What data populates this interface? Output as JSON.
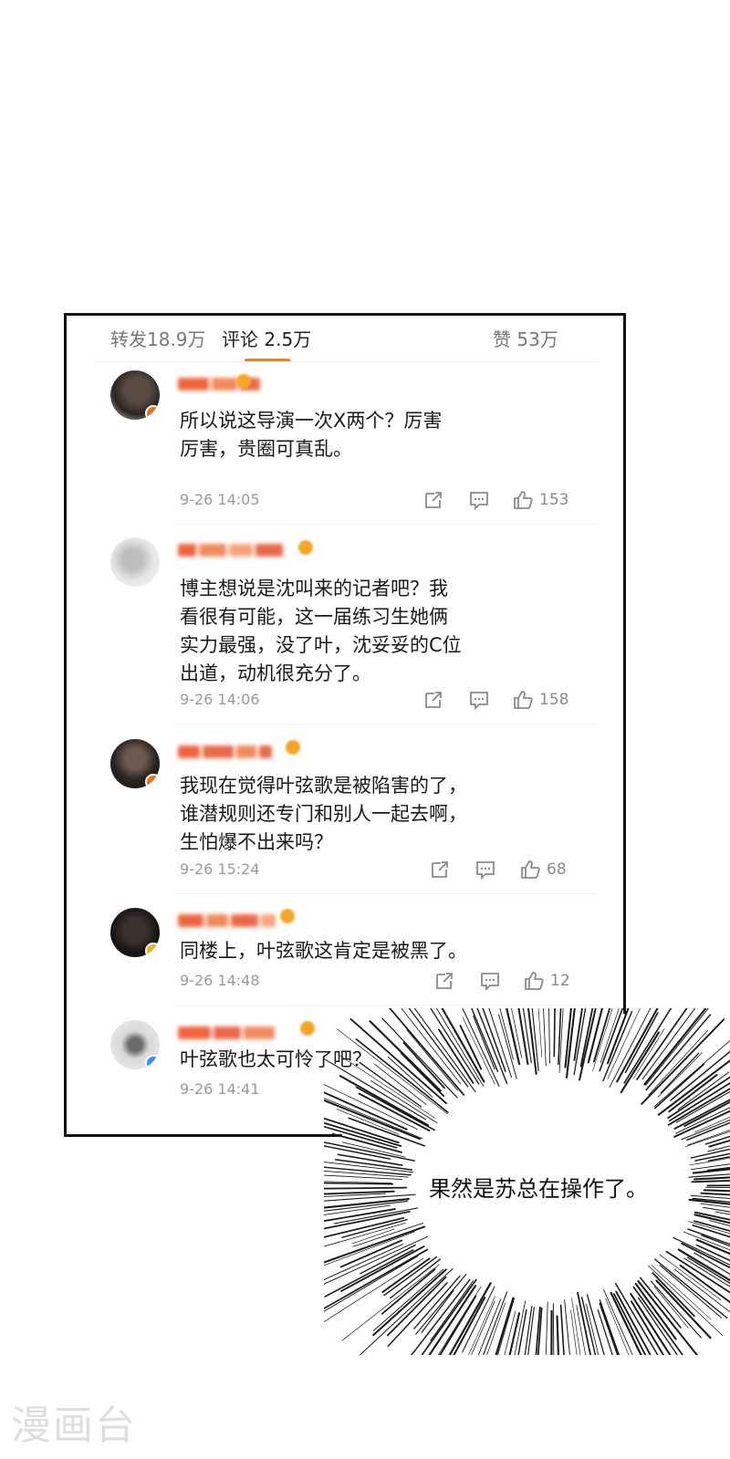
{
  "tabs": {
    "repost": "转发18.9万",
    "comments": "评论 2.5万",
    "likes": "赞 53万"
  },
  "colors": {
    "accent": "#ff8200",
    "border": "#111111",
    "meta": "#9a9a9a"
  },
  "comments": [
    {
      "text": "所以说这导演一次X两个？厉害\n厉害，贵圈可真乱。",
      "time": "9-26 14:05",
      "likes": "153"
    },
    {
      "text": "博主想说是沈叫来的记者吧？我\n看很有可能，这一届练习生她俩\n实力最强，没了叶，沈妥妥的C位\n出道，动机很充分了。",
      "time": "9-26 14:06",
      "likes": "158"
    },
    {
      "text": "我现在觉得叶弦歌是被陷害的了，\n谁潜规则还专门和别人一起去啊，\n生怕爆不出来吗？",
      "time": "9-26 15:24",
      "likes": "68"
    },
    {
      "text": "同楼上，叶弦歌这肯定是被黑了。",
      "time": "9-26 14:48",
      "likes": "12"
    },
    {
      "text": "叶弦歌也太可怜了吧？",
      "time": "9-26 14:41"
    }
  ],
  "icons": [
    "share-icon",
    "comment-icon",
    "thumbs-up-icon"
  ],
  "bubble": {
    "text": "果然是苏总在操作了。"
  },
  "watermark": "漫画台"
}
